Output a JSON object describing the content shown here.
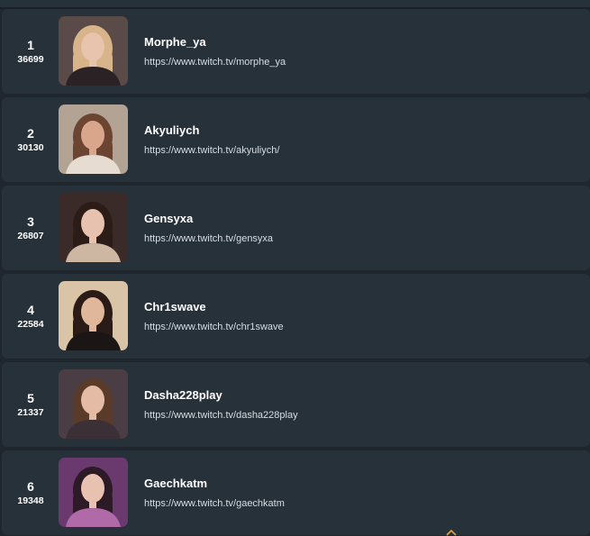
{
  "ranking": [
    {
      "rank": "1",
      "score": "36699",
      "name": "Morphe_ya",
      "url": "https://www.twitch.tv/morphe_ya",
      "palette": {
        "bg": "#5a4a48",
        "skin": "#e8c3ad",
        "hair": "#d8b48a",
        "cloth": "#2a2224"
      }
    },
    {
      "rank": "2",
      "score": "30130",
      "name": "Akyuliych",
      "url": "https://www.twitch.tv/akyuliych/",
      "palette": {
        "bg": "#b3a394",
        "skin": "#d9a68c",
        "hair": "#6b4532",
        "cloth": "#e6dcd2"
      }
    },
    {
      "rank": "3",
      "score": "26807",
      "name": "Gensyxa",
      "url": "https://www.twitch.tv/gensyxa",
      "palette": {
        "bg": "#3a2a28",
        "skin": "#e7c2ae",
        "hair": "#2b1c18",
        "cloth": "#cdb6a2"
      }
    },
    {
      "rank": "4",
      "score": "22584",
      "name": "Chr1swave",
      "url": "https://www.twitch.tv/chr1swave",
      "palette": {
        "bg": "#d9c4a8",
        "skin": "#e0b79b",
        "hair": "#2a1b16",
        "cloth": "#1b1616"
      }
    },
    {
      "rank": "5",
      "score": "21337",
      "name": "Dasha228play",
      "url": "https://www.twitch.tv/dasha228play",
      "palette": {
        "bg": "#4a3e44",
        "skin": "#e4bba4",
        "hair": "#5a3b2a",
        "cloth": "#3a3036"
      }
    },
    {
      "rank": "6",
      "score": "19348",
      "name": "Gaechkatm",
      "url": "https://www.twitch.tv/gaechkatm",
      "palette": {
        "bg": "#6a3a6e",
        "skin": "#e9c1b0",
        "hair": "#2c1a26",
        "cloth": "#b06aa8"
      }
    }
  ],
  "colors": {
    "page_bg": "#1f262d",
    "row_bg": "#27313a",
    "text_primary": "#ffffff",
    "text_link": "#d7dde2",
    "accent": "#e8a23a"
  },
  "icons": {
    "scroll_up": "chevron-up-icon"
  }
}
